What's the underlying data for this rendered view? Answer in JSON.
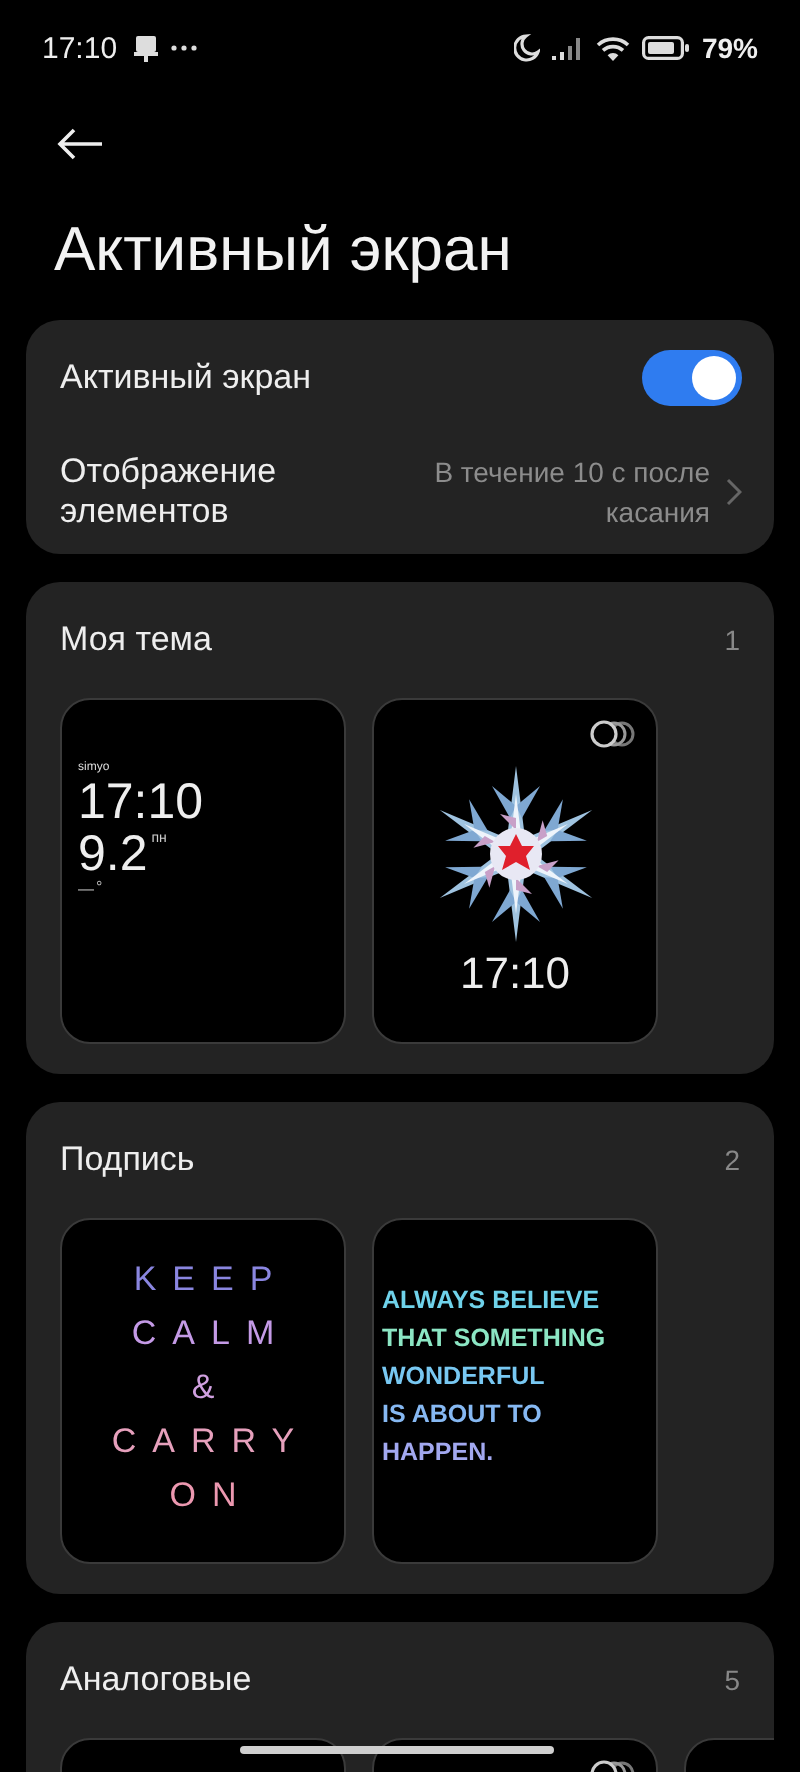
{
  "status_bar": {
    "time": "17:10",
    "battery_text": "79%"
  },
  "title": "Активный экран",
  "settings": [
    {
      "kind": "toggle",
      "label": "Активный экран",
      "on": true
    },
    {
      "kind": "link",
      "label": "Отображение элементов",
      "value": "В течение 10 с после касания"
    }
  ],
  "sections": [
    {
      "title": "Моя тема",
      "count": "1",
      "faces": [
        {
          "kind": "digital",
          "carrier": "simyo",
          "time": "17:10",
          "date": "9.2",
          "weekday": "пн",
          "weather": "—",
          "degree": "°"
        },
        {
          "kind": "snowflake",
          "time": "17:10",
          "multi": true
        }
      ]
    },
    {
      "title": "Подпись",
      "count": "2",
      "faces": [
        {
          "kind": "spaced",
          "lines": [
            {
              "text": "KEEP",
              "color": "#8a86e0"
            },
            {
              "text": "CALM",
              "color": "#c49ae6"
            },
            {
              "text": "&",
              "color": "#d0a0e0"
            },
            {
              "text": "CARRY",
              "color": "#e6a0bc"
            },
            {
              "text": "ON",
              "color": "#ec98b0"
            }
          ]
        },
        {
          "kind": "quote",
          "lines": [
            {
              "text": "ALWAYS BELIEVE",
              "color": "#6fd2ea"
            },
            {
              "text": "THAT SOMETHING",
              "color": "#8ce6c4"
            },
            {
              "text": "WONDERFUL",
              "color": "#78c8f2"
            },
            {
              "text": "IS ABOUT TO",
              "color": "#86b8f2"
            },
            {
              "text": "HAPPEN.",
              "color": "#a2a8f0"
            }
          ]
        }
      ]
    },
    {
      "title": "Аналоговые",
      "count": "5",
      "faces": [
        {
          "kind": "blank"
        },
        {
          "kind": "blank",
          "multi": true
        },
        {
          "kind": "blank"
        }
      ]
    }
  ]
}
